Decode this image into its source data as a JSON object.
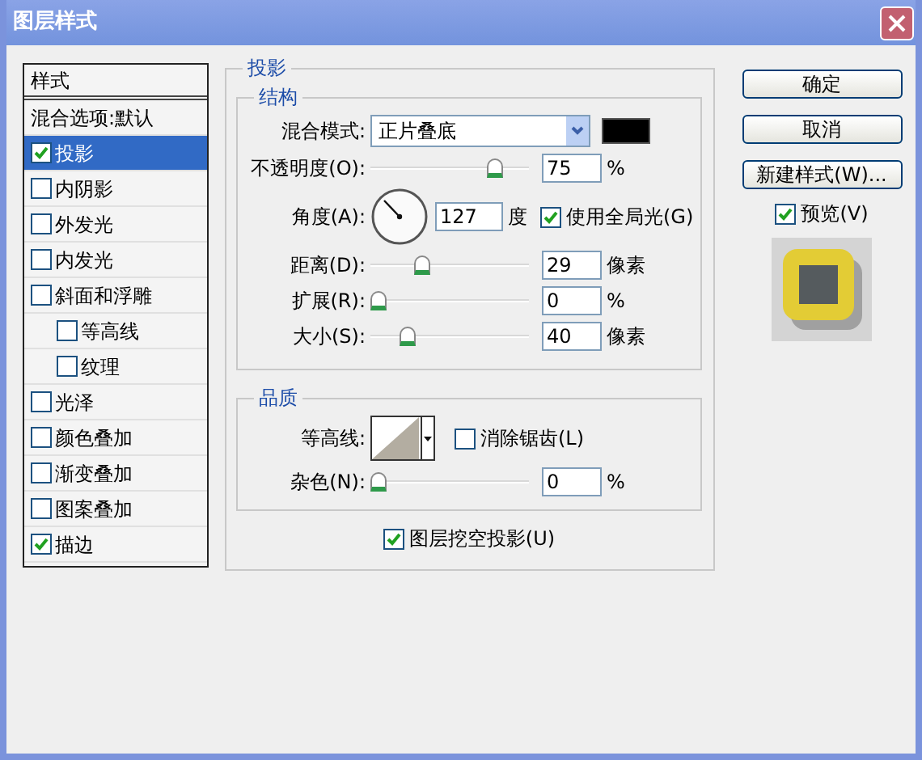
{
  "window": {
    "title": "图层样式"
  },
  "styles_list": {
    "header": "样式",
    "items": [
      {
        "label": "混合选项:默认",
        "kind": "plain",
        "selected": false
      },
      {
        "label": "投影",
        "kind": "check",
        "checked": true,
        "selected": true
      },
      {
        "label": "内阴影",
        "kind": "check",
        "checked": false,
        "selected": false
      },
      {
        "label": "外发光",
        "kind": "check",
        "checked": false,
        "selected": false
      },
      {
        "label": "内发光",
        "kind": "check",
        "checked": false,
        "selected": false
      },
      {
        "label": "斜面和浮雕",
        "kind": "check",
        "checked": false,
        "selected": false,
        "children": [
          {
            "label": "等高线",
            "kind": "check",
            "checked": false,
            "selected": false
          },
          {
            "label": "纹理",
            "kind": "check",
            "checked": false,
            "selected": false
          }
        ]
      },
      {
        "label": "光泽",
        "kind": "check",
        "checked": false,
        "selected": false
      },
      {
        "label": "颜色叠加",
        "kind": "check",
        "checked": false,
        "selected": false
      },
      {
        "label": "渐变叠加",
        "kind": "check",
        "checked": false,
        "selected": false
      },
      {
        "label": "图案叠加",
        "kind": "check",
        "checked": false,
        "selected": false
      },
      {
        "label": "描边",
        "kind": "check",
        "checked": true,
        "selected": false
      }
    ]
  },
  "panel": {
    "legend": "投影",
    "structure": {
      "legend": "结构",
      "blend_mode": {
        "label": "混合模式:",
        "value": "正片叠底"
      },
      "opacity": {
        "label": "不透明度(O):",
        "level": 0.75,
        "value": "75",
        "unit": "%"
      },
      "angle": {
        "label": "角度(A):",
        "value": "127",
        "unit": "度",
        "global_light": {
          "label": "使用全局光(G)",
          "checked": true
        }
      },
      "sliders": [
        {
          "label": "距离(D):",
          "level": 0.28,
          "value": "29",
          "unit": "像素"
        },
        {
          "label": "扩展(R):",
          "level": 0,
          "value": "0",
          "unit": "%"
        },
        {
          "label": "大小(S):",
          "level": 0.19,
          "value": "40",
          "unit": "像素"
        }
      ]
    },
    "quality": {
      "legend": "品质",
      "contour": {
        "label": "等高线:"
      },
      "anti_alias": {
        "label": "消除锯齿(L)",
        "checked": false
      },
      "noise": {
        "label": "杂色(N):",
        "level": 0,
        "value": "0",
        "unit": "%"
      }
    },
    "knockout": {
      "label": "图层挖空投影(U)",
      "checked": true
    }
  },
  "buttons": [
    "确定",
    "取消",
    "新建样式(W)..."
  ],
  "preview": {
    "label": "预览(V)",
    "checked": true
  }
}
